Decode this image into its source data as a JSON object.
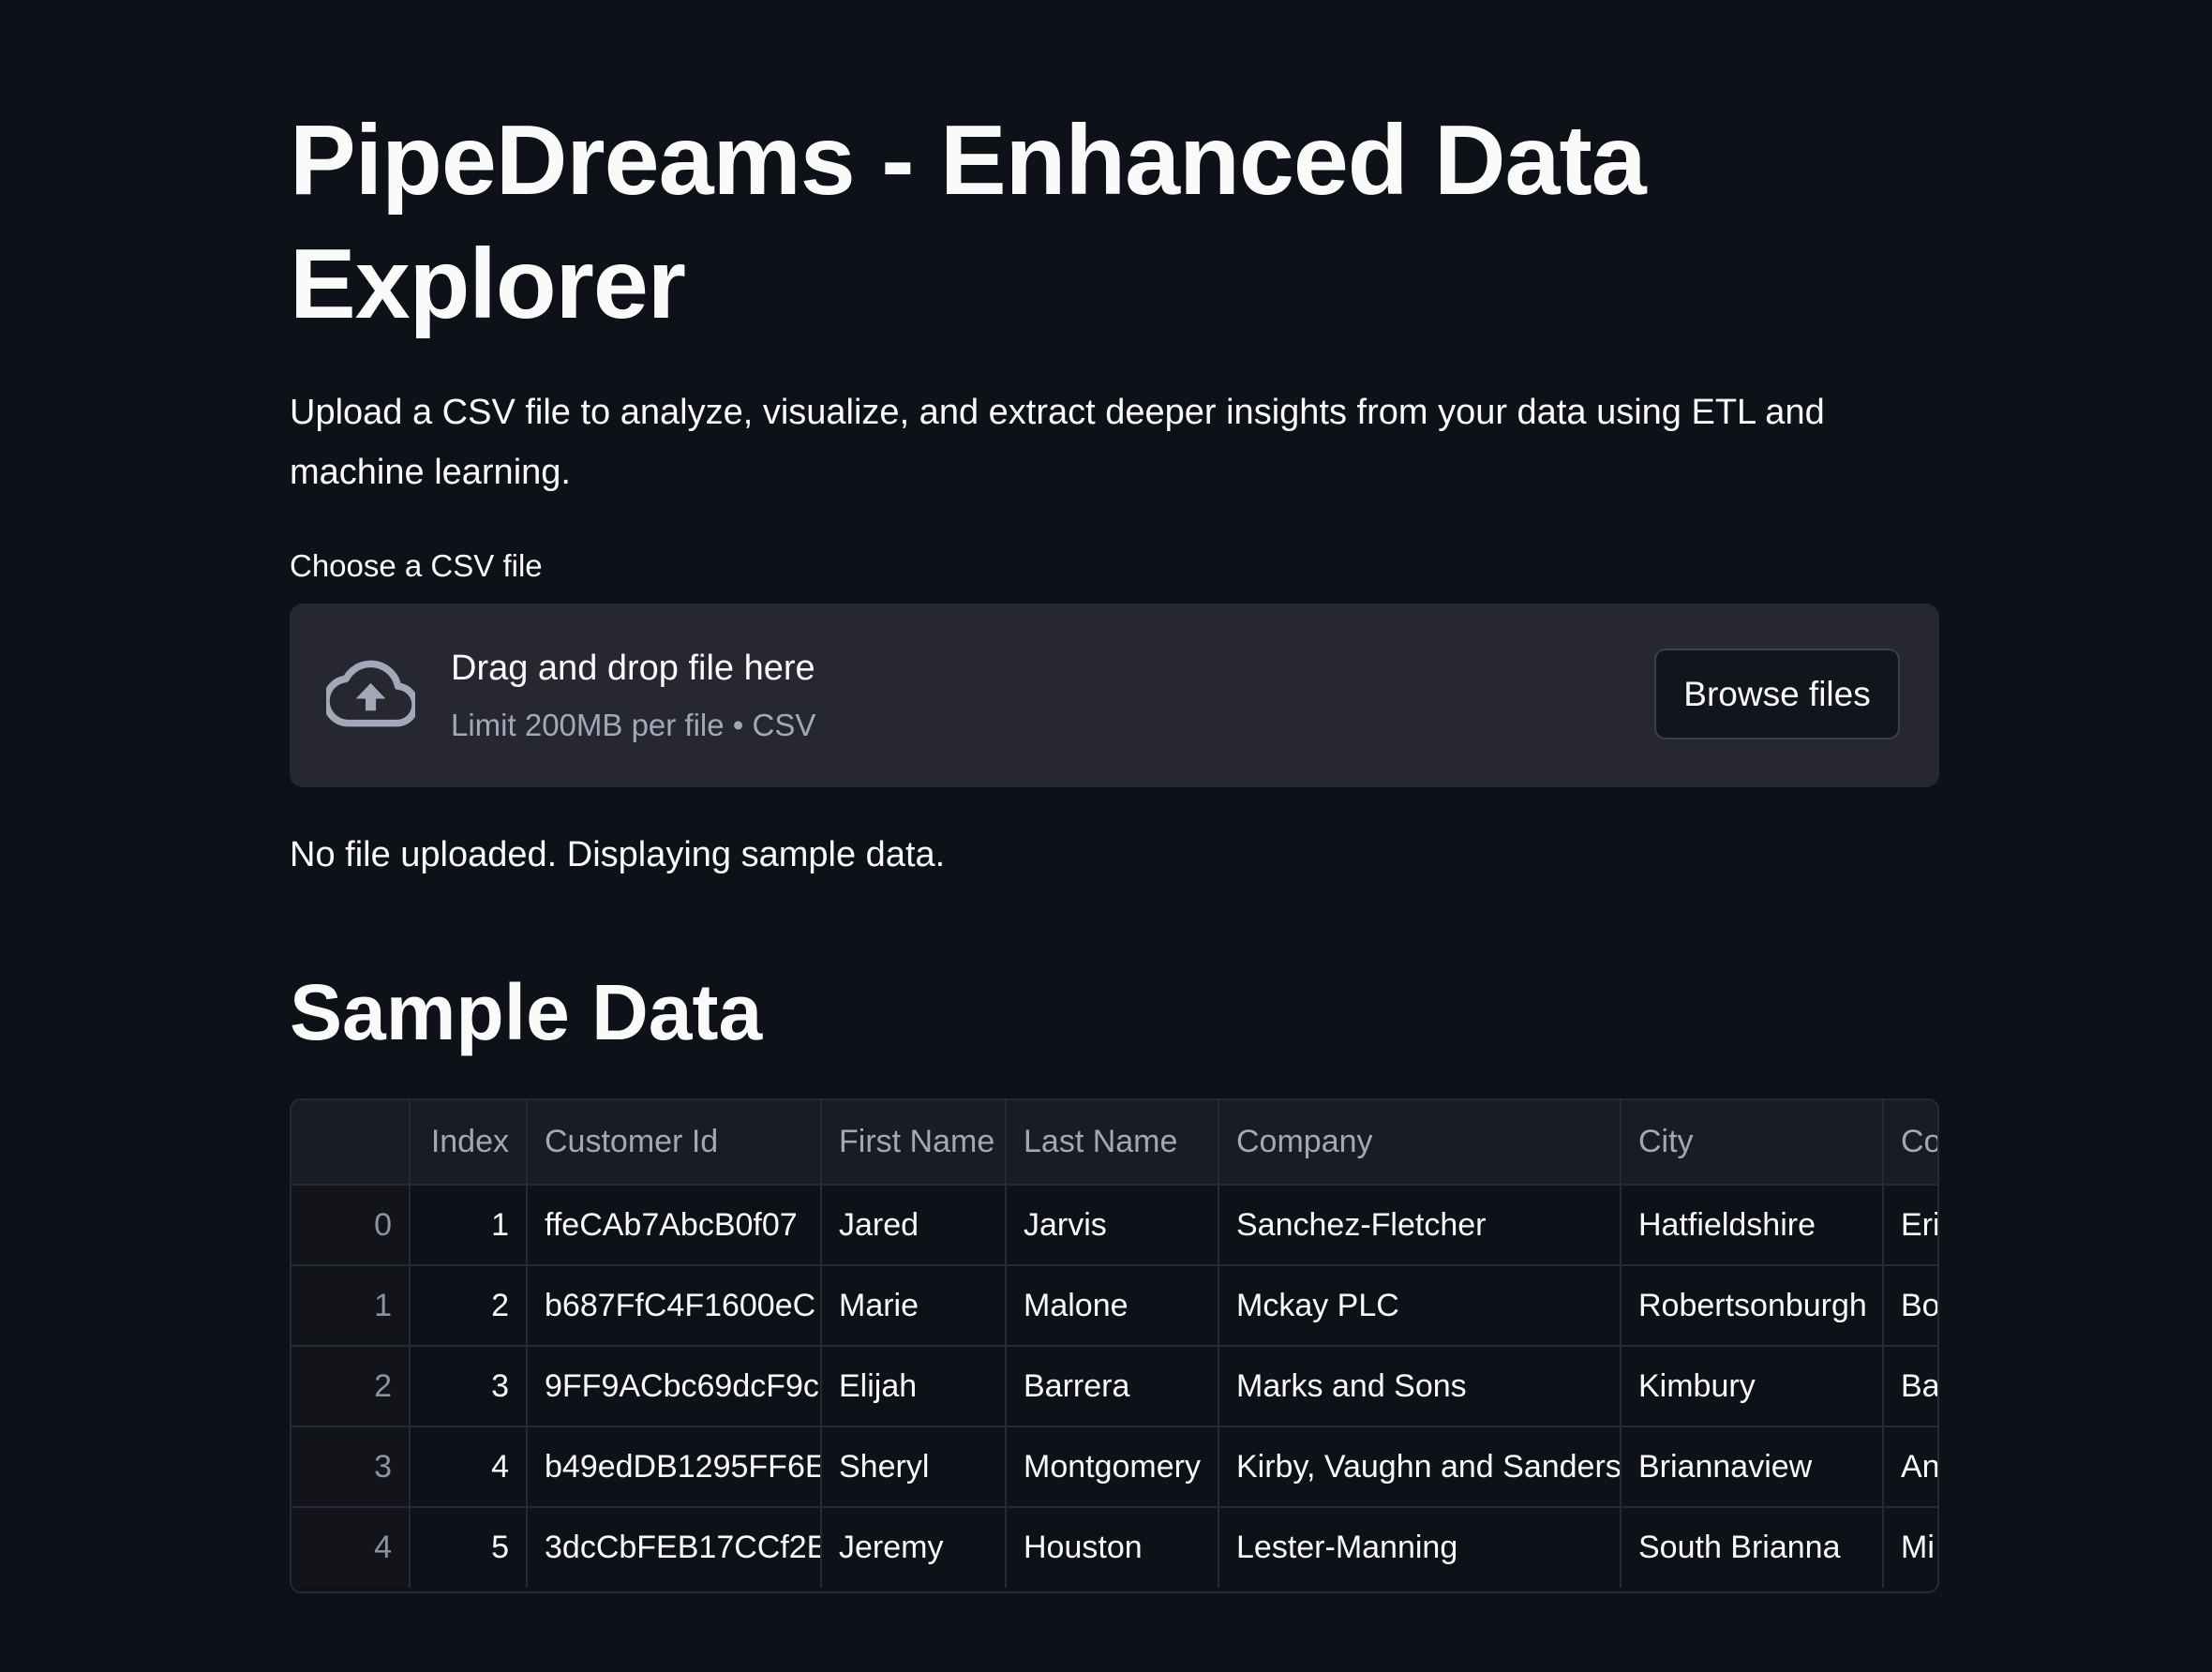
{
  "page": {
    "title": "PipeDreams - Enhanced Data Explorer",
    "intro": "Upload a CSV file to analyze, visualize, and extract deeper insights from your data using ETL and machine learning."
  },
  "uploader": {
    "label": "Choose a CSV file",
    "drop_text": "Drag and drop file here",
    "limit_text": "Limit 200MB per file • CSV",
    "browse_label": "Browse files",
    "icon": "cloud-upload-icon"
  },
  "status_message": "No file uploaded. Displaying sample data.",
  "sample_section": {
    "heading": "Sample Data"
  },
  "table": {
    "columns": [
      "",
      "Index",
      "Customer Id",
      "First Name",
      "Last Name",
      "Company",
      "City",
      "Co"
    ],
    "rows": [
      {
        "row_index": "0",
        "index": "1",
        "customer_id": "ffeCAb7AbcB0f07",
        "first_name": "Jared",
        "last_name": "Jarvis",
        "company": "Sanchez-Fletcher",
        "city": "Hatfieldshire",
        "country": "Eri"
      },
      {
        "row_index": "1",
        "index": "2",
        "customer_id": "b687FfC4F1600eC",
        "first_name": "Marie",
        "last_name": "Malone",
        "company": "Mckay PLC",
        "city": "Robertsonburgh",
        "country": "Bo"
      },
      {
        "row_index": "2",
        "index": "3",
        "customer_id": "9FF9ACbc69dcF9c",
        "first_name": "Elijah",
        "last_name": "Barrera",
        "company": "Marks and Sons",
        "city": "Kimbury",
        "country": "Ba"
      },
      {
        "row_index": "3",
        "index": "4",
        "customer_id": "b49edDB1295FF6E",
        "first_name": "Sheryl",
        "last_name": "Montgomery",
        "company": "Kirby, Vaughn and Sanders",
        "city": "Briannaview",
        "country": "An"
      },
      {
        "row_index": "4",
        "index": "5",
        "customer_id": "3dcCbFEB17CCf2E",
        "first_name": "Jeremy",
        "last_name": "Houston",
        "company": "Lester-Manning",
        "city": "South Brianna",
        "country": "Mi"
      }
    ]
  }
}
